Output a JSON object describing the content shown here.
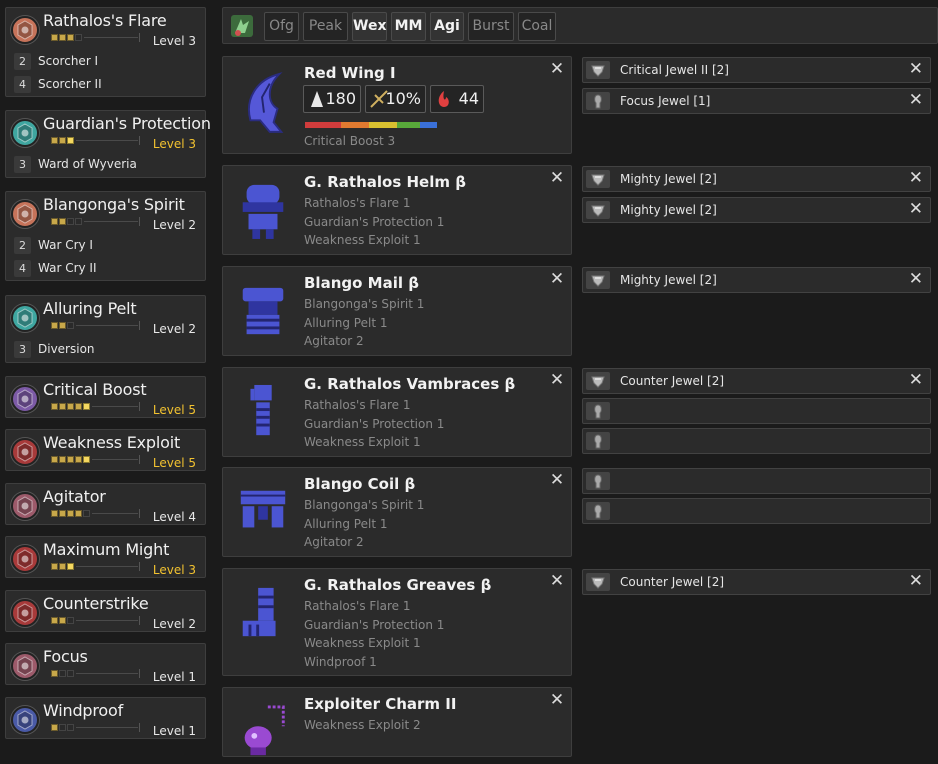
{
  "skills": [
    {
      "name": "Rathalos's Flare",
      "level": "Level 3",
      "max": false,
      "pips": [
        1,
        1,
        1,
        0
      ],
      "hlpip": -1,
      "emblem": "rathalos-emblem-icon",
      "color": "#c6735a",
      "bonuses": [
        {
          "num": "2",
          "text": "Scorcher I"
        },
        {
          "num": "4",
          "text": "Scorcher II"
        }
      ]
    },
    {
      "name": "Guardian's Protection",
      "level": "Level 3",
      "max": true,
      "pips": [
        1,
        1,
        1
      ],
      "hlpip": 2,
      "emblem": "guardian-emblem-icon",
      "color": "#3fa6a0",
      "bonuses": [
        {
          "num": "3",
          "text": "Ward of Wyveria"
        }
      ]
    },
    {
      "name": "Blangonga's Spirit",
      "level": "Level 2",
      "max": false,
      "pips": [
        1,
        1,
        0,
        0
      ],
      "hlpip": -1,
      "emblem": "blangonga-emblem-icon",
      "color": "#c6735a",
      "bonuses": [
        {
          "num": "2",
          "text": "War Cry I"
        },
        {
          "num": "4",
          "text": "War Cry II"
        }
      ]
    },
    {
      "name": "Alluring Pelt",
      "level": "Level 2",
      "max": false,
      "pips": [
        1,
        1,
        0
      ],
      "hlpip": -1,
      "emblem": "alluring-emblem-icon",
      "color": "#3fa6a0",
      "bonuses": [
        {
          "num": "3",
          "text": "Diversion"
        }
      ]
    },
    {
      "name": "Critical Boost",
      "level": "Level 5",
      "max": true,
      "pips": [
        1,
        1,
        1,
        1,
        1
      ],
      "hlpip": 4,
      "emblem": "critical-boost-icon",
      "color": "#7c5aa6",
      "bonuses": []
    },
    {
      "name": "Weakness Exploit",
      "level": "Level 5",
      "max": true,
      "pips": [
        1,
        1,
        1,
        1,
        1
      ],
      "hlpip": 4,
      "emblem": "weakness-exploit-icon",
      "color": "#a83a3a",
      "bonuses": []
    },
    {
      "name": "Agitator",
      "level": "Level 4",
      "max": false,
      "pips": [
        1,
        1,
        1,
        1,
        0
      ],
      "hlpip": -1,
      "emblem": "agitator-icon",
      "color": "#9c5a6a",
      "bonuses": []
    },
    {
      "name": "Maximum Might",
      "level": "Level 3",
      "max": true,
      "pips": [
        1,
        1,
        1
      ],
      "hlpip": 2,
      "emblem": "maximum-might-icon",
      "color": "#a83a3a",
      "bonuses": []
    },
    {
      "name": "Counterstrike",
      "level": "Level 2",
      "max": false,
      "pips": [
        1,
        1,
        0
      ],
      "hlpip": -1,
      "emblem": "counterstrike-icon",
      "color": "#a83a3a",
      "bonuses": []
    },
    {
      "name": "Focus",
      "level": "Level 1",
      "max": false,
      "pips": [
        1,
        0,
        0
      ],
      "hlpip": -1,
      "emblem": "focus-icon",
      "color": "#9c5a6a",
      "bonuses": []
    },
    {
      "name": "Windproof",
      "level": "Level 1",
      "max": false,
      "pips": [
        1,
        0,
        0
      ],
      "hlpip": -1,
      "emblem": "windproof-icon",
      "color": "#4a5aa6",
      "bonuses": []
    }
  ],
  "filters": [
    {
      "label": "Ofg",
      "active": false
    },
    {
      "label": "Peak",
      "active": false
    },
    {
      "label": "Wex",
      "active": true
    },
    {
      "label": "MM",
      "active": true
    },
    {
      "label": "Agi",
      "active": true
    },
    {
      "label": "Burst",
      "active": false
    },
    {
      "label": "Coal",
      "active": false
    }
  ],
  "weapon": {
    "name": "Red Wing I",
    "attack": "180",
    "affinity": "10%",
    "element": "44",
    "skills": [
      "Critical Boost 3"
    ],
    "sharpness_percent": {
      "red": 19,
      "orange": 15,
      "yellow": 15,
      "green": 12,
      "blue": 9
    }
  },
  "armor": [
    {
      "name": "G. Rathalos Helm β",
      "icon": "helm-icon",
      "skills": [
        "Rathalos's Flare 1",
        "Guardian's Protection 1",
        "Weakness Exploit 1"
      ]
    },
    {
      "name": "Blango Mail β",
      "icon": "chest-icon",
      "skills": [
        "Blangonga's Spirit 1",
        "Alluring Pelt 1",
        "Agitator 2"
      ]
    },
    {
      "name": "G. Rathalos Vambraces β",
      "icon": "arms-icon",
      "skills": [
        "Rathalos's Flare 1",
        "Guardian's Protection 1",
        "Weakness Exploit 1"
      ]
    },
    {
      "name": "Blango Coil β",
      "icon": "waist-icon",
      "skills": [
        "Blangonga's Spirit 1",
        "Alluring Pelt 1",
        "Agitator 2"
      ]
    },
    {
      "name": "G. Rathalos Greaves β",
      "icon": "legs-icon",
      "skills": [
        "Rathalos's Flare 1",
        "Guardian's Protection 1",
        "Weakness Exploit 1",
        "Windproof 1"
      ]
    },
    {
      "name": "Exploiter Charm II",
      "icon": "charm-icon",
      "skills": [
        "Weakness Exploit 2"
      ]
    }
  ],
  "slots": [
    {
      "label": "Critical Jewel II [2]",
      "filled": true,
      "kind": "weapon-jewel-icon"
    },
    {
      "label": "Focus Jewel [1]",
      "filled": true,
      "kind": "weapon-slot-icon"
    },
    {
      "label": "Mighty Jewel [2]",
      "filled": true,
      "kind": "armor-jewel-icon"
    },
    {
      "label": "Mighty Jewel [2]",
      "filled": true,
      "kind": "armor-jewel-icon"
    },
    {
      "label": "Mighty Jewel [2]",
      "filled": true,
      "kind": "armor-jewel-icon"
    },
    {
      "label": "Counter Jewel [2]",
      "filled": true,
      "kind": "armor-jewel-icon"
    },
    {
      "label": "",
      "filled": false,
      "kind": "empty-slot-icon"
    },
    {
      "label": "",
      "filled": false,
      "kind": "empty-slot-icon"
    },
    {
      "label": "",
      "filled": false,
      "kind": "empty-slot-icon"
    },
    {
      "label": "",
      "filled": false,
      "kind": "empty-slot-icon"
    },
    {
      "label": "Counter Jewel [2]",
      "filled": true,
      "kind": "armor-jewel-icon"
    }
  ],
  "close_symbol": "✕",
  "colors": {
    "accent_gold": "#f2c230",
    "armor_blue": "#4b55d2",
    "charm_purple": "#9a4ad2"
  }
}
